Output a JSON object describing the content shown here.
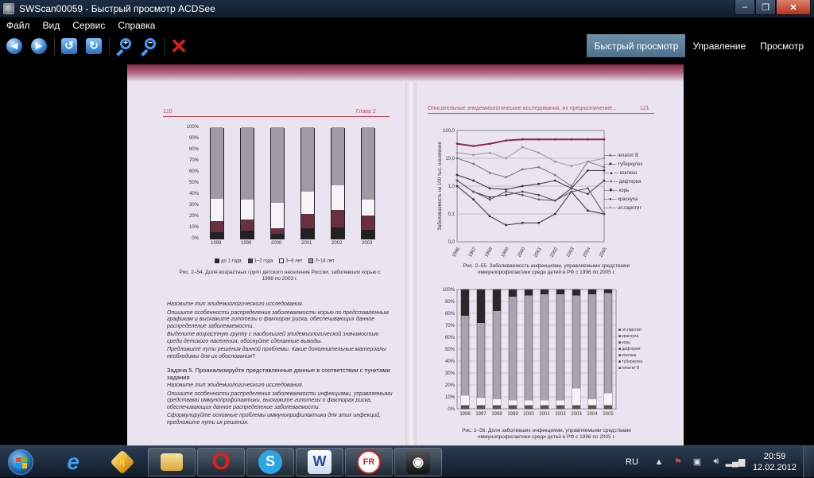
{
  "window": {
    "title": "SWScan00059 - Быстрый просмотр ACDSee",
    "minimize": "–",
    "maximize": "❐",
    "close": "✕"
  },
  "menu": [
    "Файл",
    "Вид",
    "Сервис",
    "Справка"
  ],
  "toolbar": {
    "modes": [
      "Быстрый просмотр",
      "Управление",
      "Просмотр"
    ],
    "active_mode": "Быстрый просмотр"
  },
  "document": {
    "left_page": {
      "page_number": "120",
      "chapter": "Глава 2",
      "chart": {
        "yticks": [
          "100%",
          "90%",
          "80%",
          "70%",
          "60%",
          "50%",
          "40%",
          "30%",
          "20%",
          "10%",
          "0%"
        ],
        "categories": [
          "1998",
          "1999",
          "2000",
          "2001",
          "2002",
          "2003"
        ],
        "legend": [
          "до 1 года",
          "1–2 года",
          "3–6 лет",
          "7–14 лет"
        ]
      },
      "caption": "Рис. 2–54. Доля возрастных групп детского населения России, заболевших корью с 1998 по 2003 г.",
      "bullets": [
        "Назовите тип эпидемиологического исследования.",
        "Опишите особенности распределения заболеваемости корью по представленным графикам и выскажите гипотезы о факторах риска, обеспечивающих данное распределение заболеваемости.",
        "Выделите возрастную группу с наибольшей эпидемиологической значимостью среди детского населения, обоснуйте сделанные выводы.",
        "Предложите пути решения данной проблемы. Какие дополнительные материалы необходимы для их обоснования?"
      ],
      "task_title": "Задача 5. Проанализируйте представленные данные в соответствии с пунктами задания",
      "task_items": [
        "Назовите тип эпидемиологического исследования.",
        "Опишите особенности распределения заболеваемости инфекциями, управляемыми средствами иммунопрофилактики, выскажите гипотезы о факторах риска, обеспечивающих данное распределение заболеваемости.",
        "Сформулируйте основные проблемы иммунопрофилактики для этих инфекций, предложите пути их решения."
      ]
    },
    "right_page": {
      "page_number": "121",
      "header": "Описательные эпидемиологические исследования, их предназначение...",
      "line_chart": {
        "ylabel": "Заболеваемость на 100 тыс. населения",
        "yticks": [
          "100,0",
          "10,0",
          "1,0",
          "0,1",
          "0,0"
        ],
        "xticks": [
          "1996",
          "1997",
          "1998",
          "1999",
          "2000",
          "2001",
          "2002",
          "2003",
          "2004",
          "2005"
        ],
        "legend": [
          "гепатит В",
          "туберкулез",
          "коклюш",
          "дифтерия",
          "корь",
          "краснуха",
          "эп.паротит"
        ]
      },
      "caption1": "Рис. 2–55. Заболеваемость инфекциями, управляемыми средствами иммунопрофилактики среди детей в РФ с 1996 по 2005 г.",
      "stack_chart": {
        "yticks": [
          "100%",
          "90%",
          "80%",
          "70%",
          "60%",
          "50%",
          "40%",
          "30%",
          "20%",
          "10%",
          "0%"
        ],
        "xticks": [
          "1996",
          "1997",
          "1998",
          "1999",
          "2000",
          "2001",
          "2002",
          "2003",
          "2004",
          "2005"
        ],
        "legend": [
          "эп.паротит",
          "краснуха",
          "корь",
          "дифтерия",
          "коклюш",
          "туберкулез",
          "гепатит В"
        ]
      },
      "caption2": "Рис. 2–56. Доля заболевших инфекциями, управляемыми средствами иммунопрофилактики среди детей в РФ с 1996 по 2005 г."
    }
  },
  "taskbar": {
    "language": "RU",
    "time": "20:59",
    "date": "12.02.2012"
  }
}
